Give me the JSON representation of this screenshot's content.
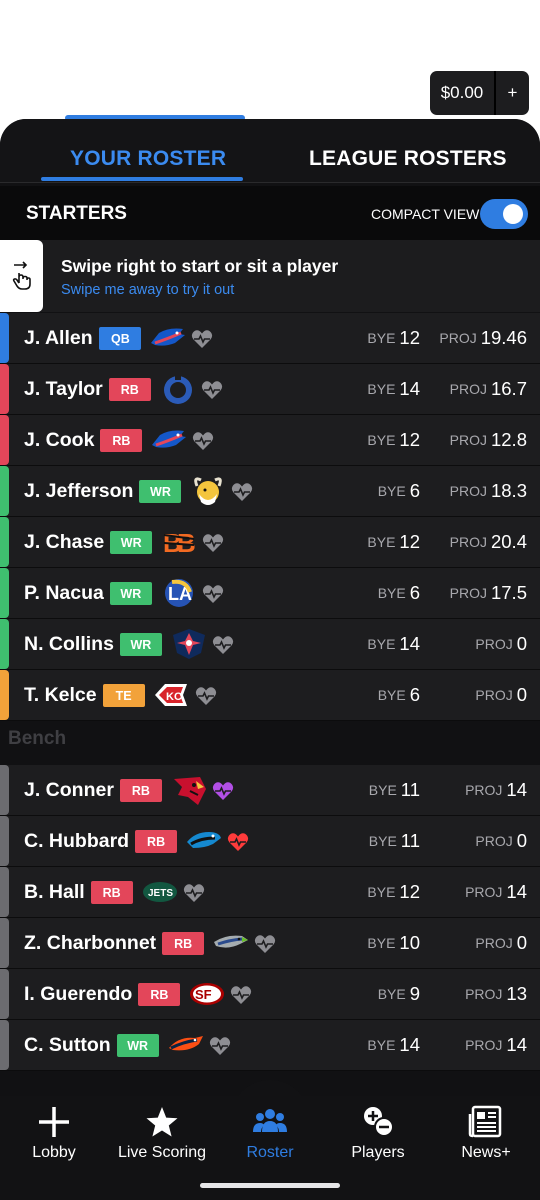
{
  "balance": {
    "amount": "$0.00",
    "add": "+"
  },
  "tabs": {
    "yours": "YOUR ROSTER",
    "league": "LEAGUE ROSTERS"
  },
  "starters": {
    "title": "STARTERS",
    "compact_label": "COMPACT VIEW",
    "compact_on": true
  },
  "tip": {
    "title": "Swipe right to start or sit a player",
    "subtitle": "Swipe me away to try it out"
  },
  "bench_label": "Bench",
  "labels": {
    "bye": "BYE",
    "proj": "PROJ"
  },
  "colors": {
    "accent": "#2f7de1",
    "QB": "#2f7de1",
    "RB": "#e3465a",
    "WR": "#3fbf6f",
    "TE": "#f2a23a",
    "bench": "#6c6c70"
  },
  "starters_rows": [
    {
      "name": "J. Allen",
      "pos": "QB",
      "team": "bills-logo",
      "bye": "12",
      "proj": "19.46",
      "heart": "gray"
    },
    {
      "name": "J. Taylor",
      "pos": "RB",
      "team": "colts-logo",
      "bye": "14",
      "proj": "16.7",
      "heart": "gray"
    },
    {
      "name": "J. Cook",
      "pos": "RB",
      "team": "bills-logo",
      "bye": "12",
      "proj": "12.8",
      "heart": "gray"
    },
    {
      "name": "J. Jefferson",
      "pos": "WR",
      "team": "vikings-logo",
      "bye": "6",
      "proj": "18.3",
      "heart": "gray"
    },
    {
      "name": "J. Chase",
      "pos": "WR",
      "team": "bengals-logo",
      "bye": "12",
      "proj": "20.4",
      "heart": "gray"
    },
    {
      "name": "P. Nacua",
      "pos": "WR",
      "team": "rams-logo",
      "bye": "6",
      "proj": "17.5",
      "heart": "gray"
    },
    {
      "name": "N. Collins",
      "pos": "WR",
      "team": "texans-logo",
      "bye": "14",
      "proj": "0",
      "heart": "gray"
    },
    {
      "name": "T. Kelce",
      "pos": "TE",
      "team": "chiefs-logo",
      "bye": "6",
      "proj": "0",
      "heart": "gray"
    }
  ],
  "bench_rows": [
    {
      "name": "J. Conner",
      "pos": "RB",
      "team": "cardinals-logo",
      "bye": "11",
      "proj": "14",
      "heart": "purple"
    },
    {
      "name": "C. Hubbard",
      "pos": "RB",
      "team": "panthers-logo",
      "bye": "11",
      "proj": "0",
      "heart": "red"
    },
    {
      "name": "B. Hall",
      "pos": "RB",
      "team": "jets-logo",
      "bye": "12",
      "proj": "14",
      "heart": "gray"
    },
    {
      "name": "Z. Charbonnet",
      "pos": "RB",
      "team": "seahawks-logo",
      "bye": "10",
      "proj": "0",
      "heart": "gray"
    },
    {
      "name": "I. Guerendo",
      "pos": "RB",
      "team": "49ers-logo",
      "bye": "9",
      "proj": "13",
      "heart": "gray"
    },
    {
      "name": "C. Sutton",
      "pos": "WR",
      "team": "broncos-logo",
      "bye": "14",
      "proj": "14",
      "heart": "gray"
    }
  ],
  "nav": [
    {
      "label": "Lobby",
      "icon": "plus-icon",
      "active": false
    },
    {
      "label": "Live Scoring",
      "icon": "star-icon",
      "active": false
    },
    {
      "label": "Roster",
      "icon": "group-icon",
      "active": true
    },
    {
      "label": "Players",
      "icon": "plus-minus-icon",
      "active": false
    },
    {
      "label": "News+",
      "icon": "newspaper-icon",
      "active": false
    }
  ]
}
